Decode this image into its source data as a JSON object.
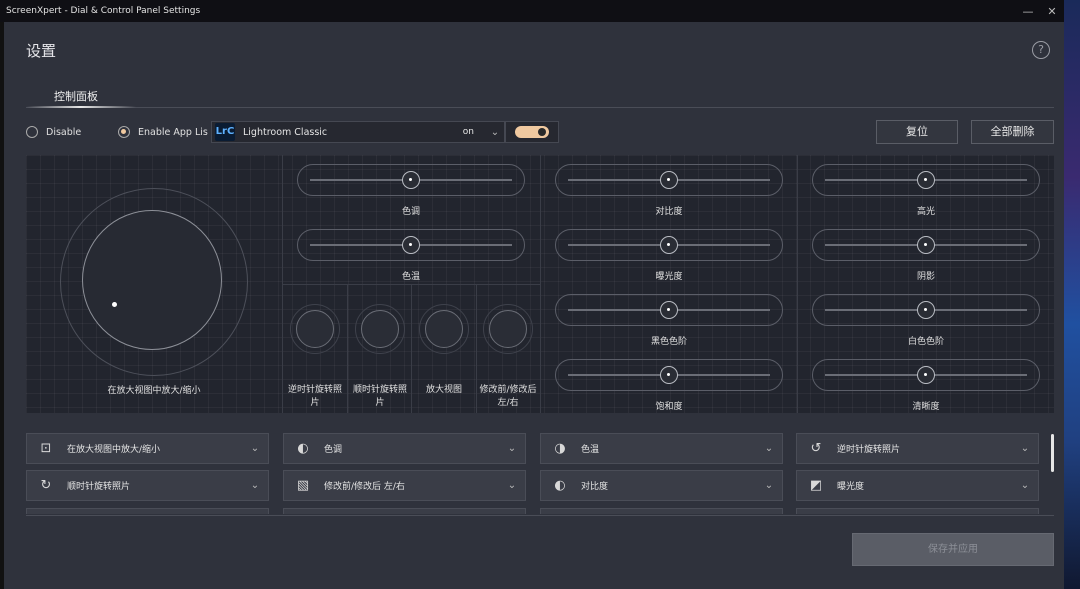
{
  "window": {
    "title": "ScreenXpert - Dial & Control Panel Settings",
    "minimize": "—",
    "close": "✕"
  },
  "header": {
    "title": "设置",
    "help": "?"
  },
  "tabs": [
    {
      "label": "控制面板"
    }
  ],
  "mode": {
    "disable_label": "Disable",
    "enable_label": "Enable App Lis",
    "selected": "enable"
  },
  "app_select": {
    "icon_text": "LrC",
    "name": "Lightroom Classic",
    "state": "on",
    "toggle_on": true
  },
  "buttons": {
    "reset": "复位",
    "delete_all": "全部删除",
    "save": "保存并应用"
  },
  "panel": {
    "dial_label": "在放大视图中放大/缩小",
    "sliders": [
      {
        "label": "色调"
      },
      {
        "label": "色温"
      },
      {
        "label": "对比度"
      },
      {
        "label": "曝光度"
      },
      {
        "label": "黑色色阶"
      },
      {
        "label": "饱和度"
      },
      {
        "label": "高光"
      },
      {
        "label": "阴影"
      },
      {
        "label": "白色色阶"
      },
      {
        "label": "清晰度"
      }
    ],
    "round_buttons": [
      {
        "label": "逆时针旋转照片"
      },
      {
        "label": "顺时针旋转照片"
      },
      {
        "label": "放大视图"
      },
      {
        "label": "修改前/修改后 左/右"
      }
    ]
  },
  "assignments": [
    {
      "icon": "zoom-frame-icon",
      "glyph": "⊡",
      "label": "在放大视图中放大/缩小"
    },
    {
      "icon": "tone-icon",
      "glyph": "◐",
      "label": "色调"
    },
    {
      "icon": "temperature-icon",
      "glyph": "◑",
      "label": "色温"
    },
    {
      "icon": "rotate-ccw-icon",
      "glyph": "↺",
      "label": "逆时针旋转照片"
    },
    {
      "icon": "rotate-cw-icon",
      "glyph": "↻",
      "label": "顺时针旋转照片"
    },
    {
      "icon": "before-after-icon",
      "glyph": "▧",
      "label": "修改前/修改后 左/右"
    },
    {
      "icon": "contrast-icon",
      "glyph": "◐",
      "label": "对比度"
    },
    {
      "icon": "exposure-icon",
      "glyph": "◩",
      "label": "曝光度"
    }
  ],
  "colors": {
    "accent": "#f0c9a0",
    "background": "#2f323c",
    "panel": "#22252e"
  }
}
